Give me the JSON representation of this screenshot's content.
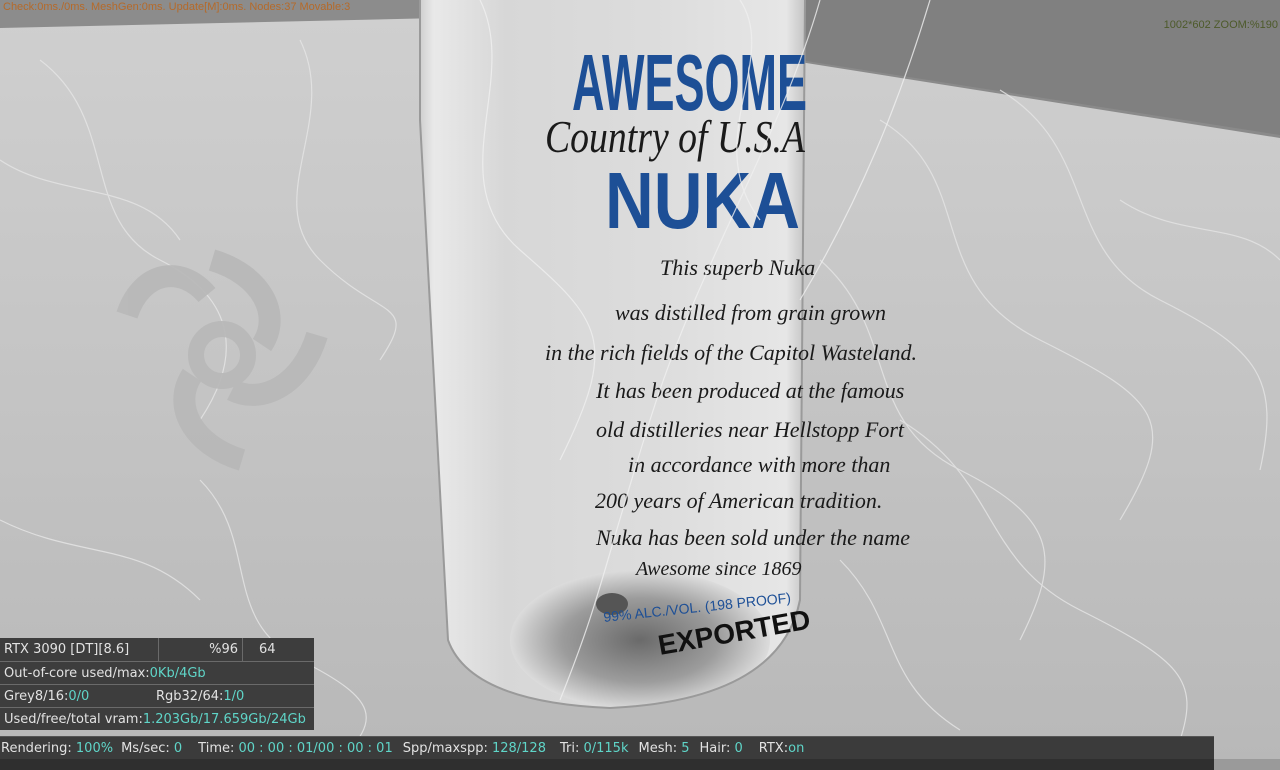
{
  "overlay": {
    "top_stats": "Check:0ms./0ms. MeshGen:0ms. Update[M]:0ms. Nodes:37 Movable:3",
    "resolution_zoom": "1002*602 ZOOM:%190"
  },
  "label": {
    "brand_line1": "AWESOME",
    "script_line": "Country of U.S.A",
    "brand_line2": "NUKA",
    "body_lines": [
      "This superb Nuka",
      "was distilled from grain grown",
      "in the rich fields of the Capitol Wasteland.",
      "It has been produced at the famous",
      "old distilleries near Hellstopp Fort",
      "in accordance with more than",
      "200 years of American tradition.",
      "Nuka has been sold under the name",
      "Awesome since 1869"
    ],
    "alc_line": "99% ALC./VOL. (198 PROOF)",
    "exported_line": "EXPORTED"
  },
  "hud": {
    "gpu": "RTX 3090 [DT][8.6]",
    "percent": "%96",
    "count": "64",
    "ooc_label": "Out-of-core used/max:",
    "ooc_value": "0Kb/4Gb",
    "grey_label": "Grey8/16: ",
    "grey_value": "0/0",
    "rgb_label": "Rgb32/64: ",
    "rgb_value": "1/0",
    "vram_label": "Used/free/total vram: ",
    "vram_value": "1.203Gb/17.659Gb/24Gb"
  },
  "status": {
    "rendering_label": "Rendering: ",
    "rendering_value": "100%",
    "ms_label": "Ms/sec: ",
    "ms_value": "0",
    "time_label": "Time: ",
    "time_value": "00 : 00 : 01/00 : 00 : 01",
    "spp_label": "Spp/maxspp: ",
    "spp_value": "128/128",
    "tri_label": "Tri: ",
    "tri_value": "0/115k",
    "mesh_label": "Mesh: ",
    "mesh_value": "5",
    "hair_label": "Hair: ",
    "hair_value": "0",
    "rtx_label": "RTX:",
    "rtx_value": "on"
  },
  "colors": {
    "brand_blue": "#1d4f96",
    "hud_value": "#5fd5c8",
    "stats_orange": "#b56a2a"
  },
  "icons": {
    "watermark": "octane-logo-icon"
  }
}
